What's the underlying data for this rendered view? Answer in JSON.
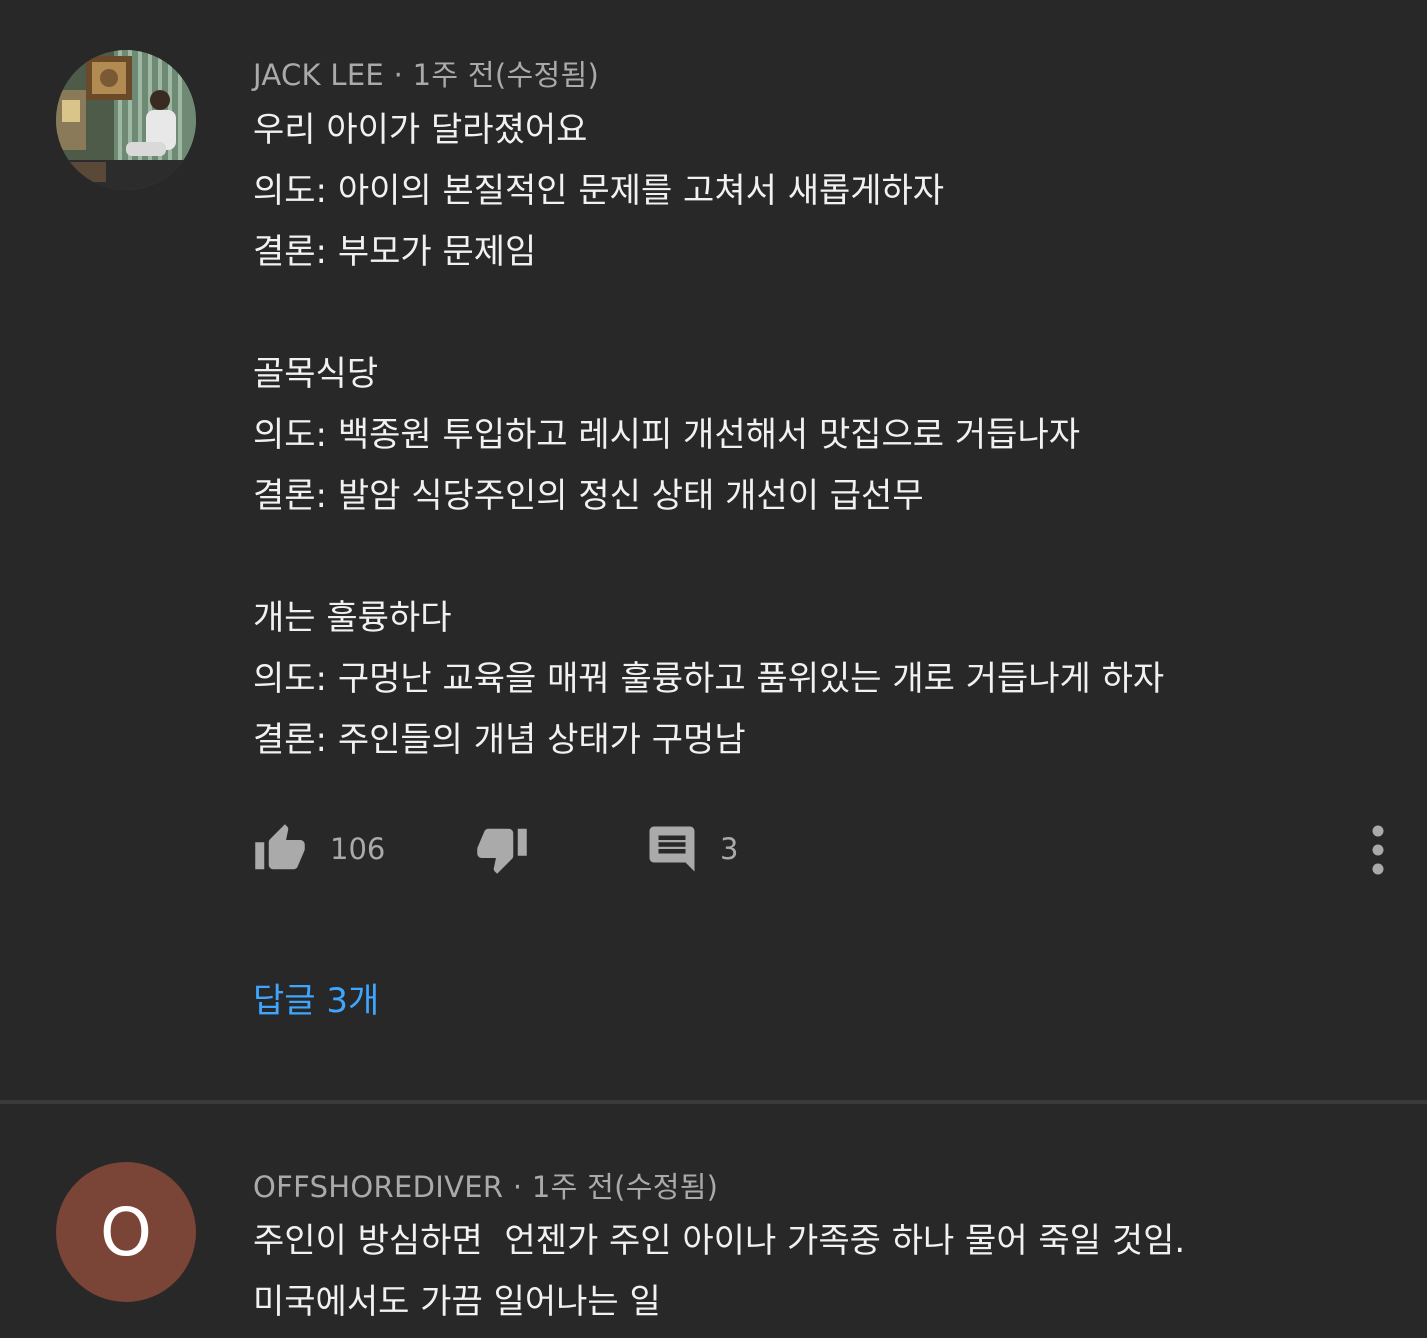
{
  "comments": [
    {
      "author": "JACK LEE",
      "separator": "·",
      "time": "1주 전(수정됨)",
      "avatar_icon": "user-photo-avatar",
      "lines": [
        "우리 아이가 달라졌어요",
        "의도: 아이의 본질적인 문제를 고쳐서 새롭게하자",
        "결론: 부모가 문제임",
        "",
        "골목식당",
        "의도: 백종원 투입하고 레시피 개선해서 맛집으로 거듭나자",
        "결론: 발암 식당주인의 정신 상태 개선이 급선무",
        "",
        "개는 훌륭하다",
        "의도: 구멍난 교육을 매꿔 훌륭하고 품위있는 개로 거듭나게 하자",
        "결론: 주인들의 개념 상태가 구멍남"
      ],
      "like_count": "106",
      "reply_count": "3",
      "replies_label": "답글 3개"
    },
    {
      "author": "OFFSHOREDIVER",
      "separator": "·",
      "time": "1주 전(수정됨)",
      "avatar_letter": "O",
      "lines": [
        "주인이 방심하면  언젠가 주인 아이나 가족중 하나 물어 죽일 것임.",
        "미국에서도 가끔 일어나는 일"
      ]
    }
  ],
  "colors": {
    "background": "#282828",
    "text_primary": "#f1f1f1",
    "text_secondary": "#aaaaaa",
    "link": "#3ea6ff",
    "letter_avatar": "#7a4436"
  },
  "icons": {
    "like": "thumbs-up-icon",
    "dislike": "thumbs-down-icon",
    "reply": "comment-icon",
    "more": "more-vertical-icon"
  }
}
